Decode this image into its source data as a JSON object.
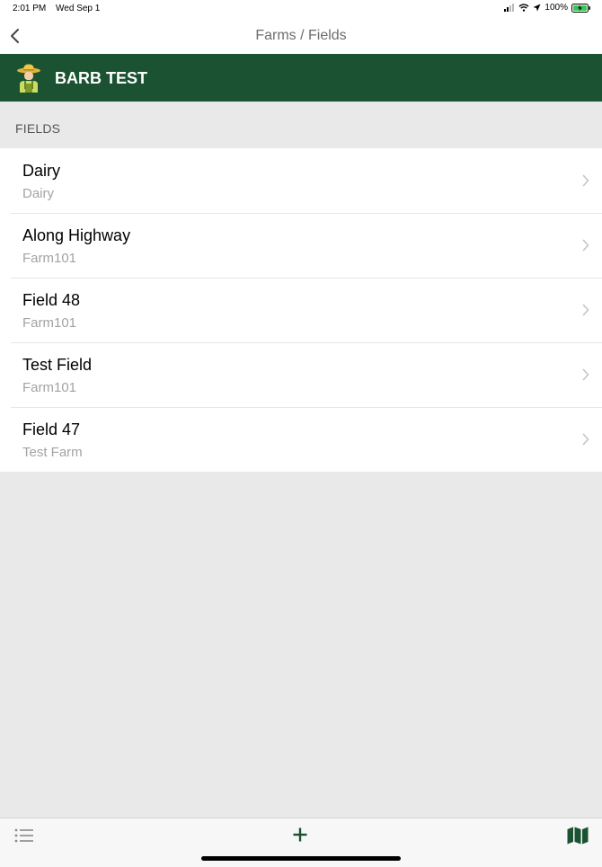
{
  "status_bar": {
    "time": "2:01 PM",
    "date": "Wed Sep 1",
    "battery": "100%"
  },
  "nav": {
    "title": "Farms / Fields",
    "back_icon": "chevron-left-icon"
  },
  "farm": {
    "name": "BARB TEST",
    "icon": "farmer-icon"
  },
  "section": {
    "label": "FIELDS"
  },
  "fields": [
    {
      "name": "Dairy",
      "farm": "Dairy"
    },
    {
      "name": "Along Highway",
      "farm": "Farm101"
    },
    {
      "name": "Field 48",
      "farm": "Farm101"
    },
    {
      "name": "Test Field",
      "farm": "Farm101"
    },
    {
      "name": "Field 47",
      "farm": "Test Farm"
    }
  ],
  "tab_bar": {
    "list_icon": "list-icon",
    "add_icon": "plus-icon",
    "map_icon": "map-icon"
  },
  "colors": {
    "brand_green": "#1a5232",
    "background": "#e9e9e9"
  }
}
